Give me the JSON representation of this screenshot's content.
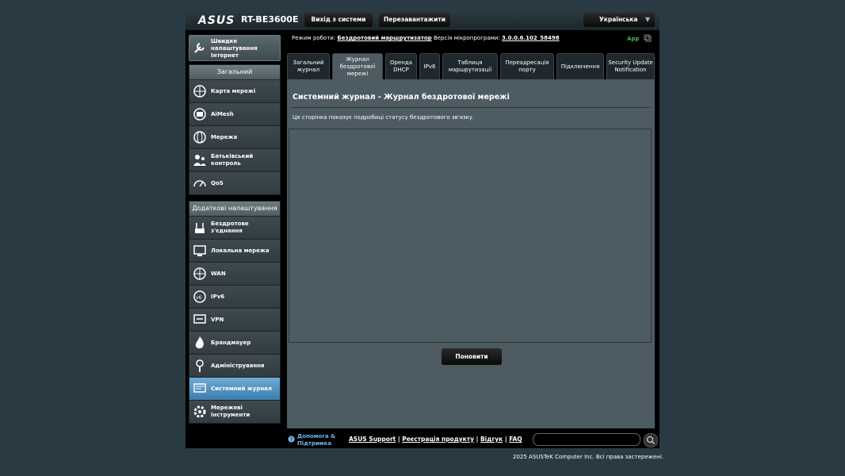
{
  "header": {
    "logo": "ASUS",
    "model": "RT-BE3600E",
    "logout_label": "Вихід з системи",
    "reboot_label": "Перезавантажити",
    "language": "Українська"
  },
  "status": {
    "mode_label": "Режим роботи:",
    "mode_value": "Бездротовий маршрутизатор",
    "firmware_label": "Версія мікропрограми:",
    "firmware_value": "3.0.0.6.102_58498",
    "app_label": "App"
  },
  "sidebar": {
    "quick_setup": "Швидке налаштування Інтернет",
    "general_header": "Загальний",
    "general_items": [
      {
        "label": "Карта мережі",
        "icon": "network-map-icon"
      },
      {
        "label": "AiMesh",
        "icon": "aimesh-icon"
      },
      {
        "label": "Мережа",
        "icon": "network-icon"
      },
      {
        "label": "Батьківський контроль",
        "icon": "parental-control-icon"
      },
      {
        "label": "QoS",
        "icon": "qos-icon"
      }
    ],
    "advanced_header": "Додаткові налаштування",
    "advanced_items": [
      {
        "label": "Бездротове з'єднання",
        "icon": "wireless-icon"
      },
      {
        "label": "Локальна мережа",
        "icon": "lan-icon"
      },
      {
        "label": "WAN",
        "icon": "wan-icon"
      },
      {
        "label": "IPv6",
        "icon": "ipv6-icon"
      },
      {
        "label": "VPN",
        "icon": "vpn-icon"
      },
      {
        "label": "Брандмауер",
        "icon": "firewall-icon"
      },
      {
        "label": "Адміністрування",
        "icon": "administration-icon"
      },
      {
        "label": "Системний журнал",
        "icon": "system-log-icon",
        "active": true
      },
      {
        "label": "Мережеві інструменти",
        "icon": "network-tools-icon"
      }
    ]
  },
  "tabs": [
    {
      "label": "Загальний журнал"
    },
    {
      "label": "Журнал бездротової мережі",
      "active": true
    },
    {
      "label": "Оренда DHCP"
    },
    {
      "label": "IPv6"
    },
    {
      "label": "Таблиця маршрутизації"
    },
    {
      "label": "Переадресація порту"
    },
    {
      "label": "Підключення"
    },
    {
      "label": "Security Update Notification"
    }
  ],
  "main": {
    "title": "Системний журнал - Журнал бездротової мережі",
    "description": "Ця сторінка показує подробиці статусу бездротового зв'язку.",
    "log_content": "",
    "refresh_label": "Поновити"
  },
  "footer": {
    "help": "Допомога & Підтримка",
    "links": [
      "ASUS Support",
      "Реєстрація продукту",
      "Відгук",
      "FAQ"
    ],
    "search_value": "",
    "copyright": "2025 ASUSTeK Computer Inc. Всі права застережені."
  }
}
